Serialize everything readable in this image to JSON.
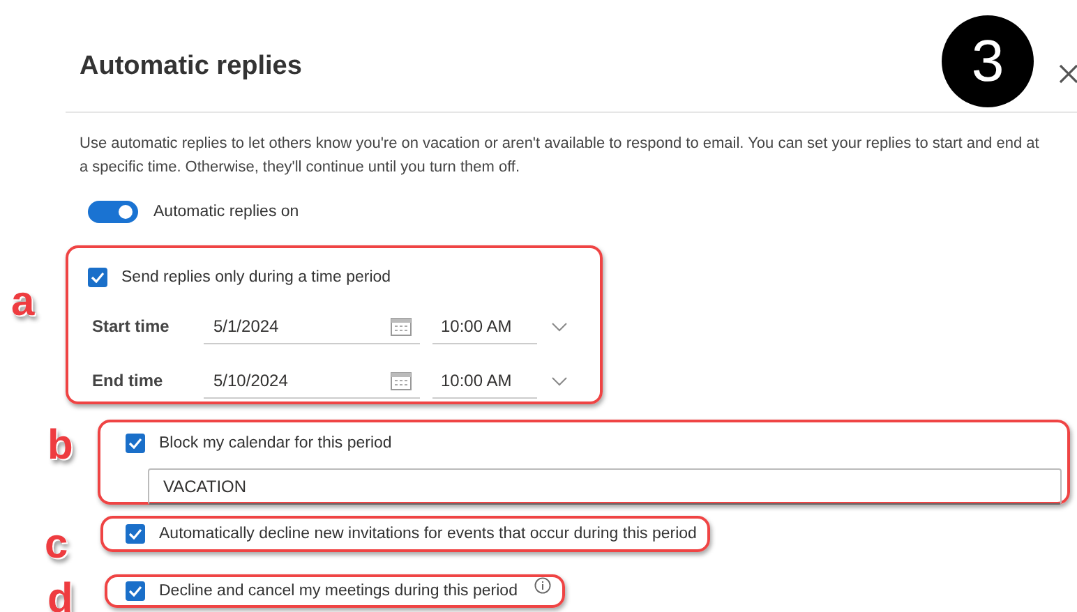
{
  "dialog": {
    "title": "Automatic replies",
    "description": "Use automatic replies to let others know you're on vacation or aren't available to respond to email. You can set your replies to start and end at a specific time. Otherwise, they'll continue until you turn them off."
  },
  "step_badge": "3",
  "toggle": {
    "label": "Automatic replies on",
    "on": true
  },
  "sections": [
    {
      "marker": "a",
      "kind": "period",
      "checkbox": {
        "label": "Send replies only during a time period",
        "checked": true
      },
      "rows": [
        {
          "label": "Start time",
          "date": "5/1/2024",
          "time": "10:00 AM"
        },
        {
          "label": "End time",
          "date": "5/10/2024",
          "time": "10:00 AM"
        }
      ]
    },
    {
      "marker": "b",
      "kind": "block",
      "checkbox": {
        "label": "Block my calendar for this period",
        "checked": true
      },
      "field_value": "VACATION"
    },
    {
      "marker": "c",
      "kind": "option",
      "checkbox": {
        "label": "Automatically decline new invitations for events that occur during this period",
        "checked": true
      }
    },
    {
      "marker": "d",
      "kind": "option",
      "checkbox": {
        "label": "Decline and cancel my meetings during this period",
        "checked": true
      },
      "info": true
    }
  ]
}
